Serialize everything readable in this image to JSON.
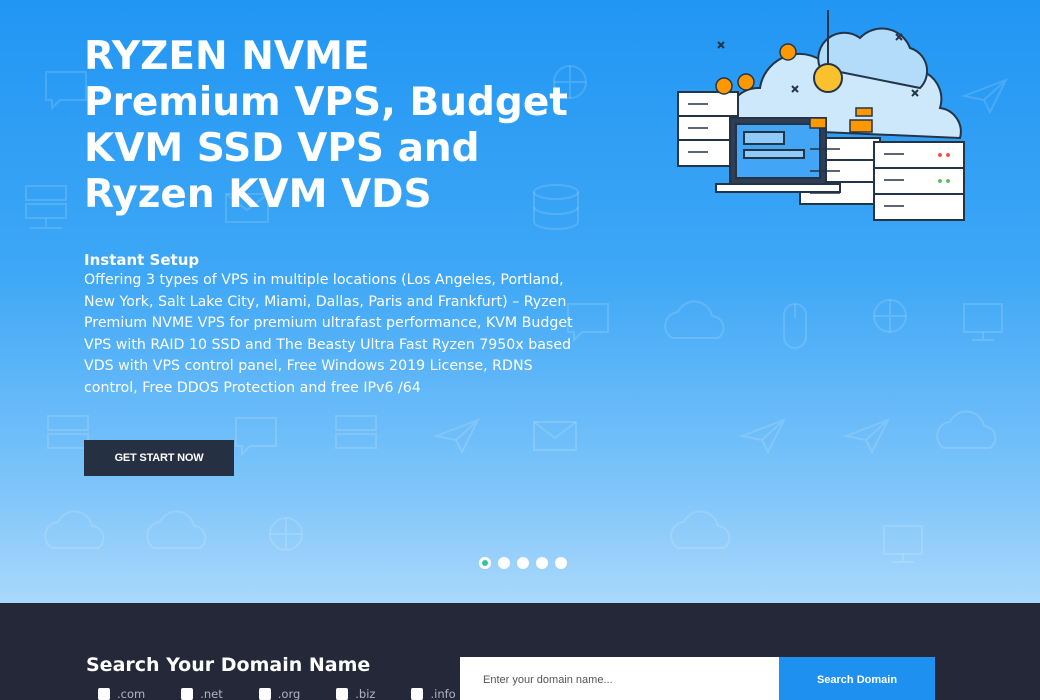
{
  "hero": {
    "title": "RYZEN NVME Premium VPS, Budget KVM SSD VPS and Ryzen KVM VDS",
    "subtitle": "Instant Setup",
    "description": "Offering 3 types of VPS in multiple locations (Los Angeles, Portland, New York, Salt Lake City, Miami, Dallas, Paris and Frankfurt) – Ryzen Premium NVME VPS for premium ultrafast performance, KVM Budget VPS with RAID 10 SSD and The Beasty Ultra Fast Ryzen 7950x based VDS with  VPS control panel, Free Windows 2019 License, RDNS control, Free DDOS Protection and free IPv6 /64",
    "cta_label": "GET START NOW",
    "illustration": "server-cloud-illustration"
  },
  "slider": {
    "count": 5,
    "active_index": 0
  },
  "domain_search": {
    "title": "Search Your Domain Name",
    "placeholder": "Enter your domain name...",
    "button_label": "Search Domain",
    "tlds": [
      ".com",
      ".net",
      ".org",
      ".biz",
      ".info"
    ]
  },
  "colors": {
    "hero_top": "#2196f3",
    "hero_bottom": "#a9d8fb",
    "dark": "#242838",
    "cta_bg": "#263043",
    "accent": "#1e90f0",
    "active_dot": "#33c3a0"
  }
}
